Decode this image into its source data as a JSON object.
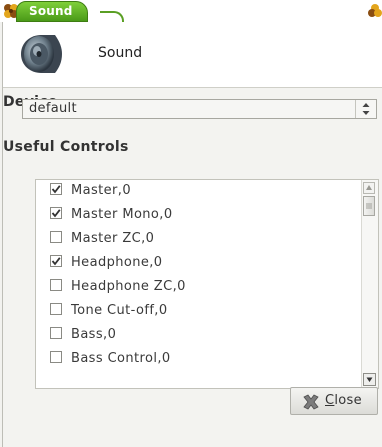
{
  "window": {
    "title": "Sound",
    "left_icon": "clover-icon",
    "right_icon": "clover-icon"
  },
  "header": {
    "icon": "speaker-icon",
    "title": "Sound"
  },
  "device": {
    "label": "Device",
    "selected": "default",
    "arrows_icon": "spin-arrows-icon"
  },
  "controls": {
    "label": "Useful Controls",
    "items": [
      {
        "label": "Master,0",
        "checked": true
      },
      {
        "label": "Master Mono,0",
        "checked": true
      },
      {
        "label": "Master ZC,0",
        "checked": false
      },
      {
        "label": "Headphone,0",
        "checked": true
      },
      {
        "label": "Headphone ZC,0",
        "checked": false
      },
      {
        "label": "Tone Cut-off,0",
        "checked": false
      },
      {
        "label": "Bass,0",
        "checked": false
      },
      {
        "label": "Bass Control,0",
        "checked": false
      }
    ]
  },
  "close_button": {
    "mnemonic": "C",
    "rest": "lose",
    "icon": "close-x-icon"
  },
  "colors": {
    "title_tab": "#5ca922",
    "accent_check": "#333333"
  }
}
